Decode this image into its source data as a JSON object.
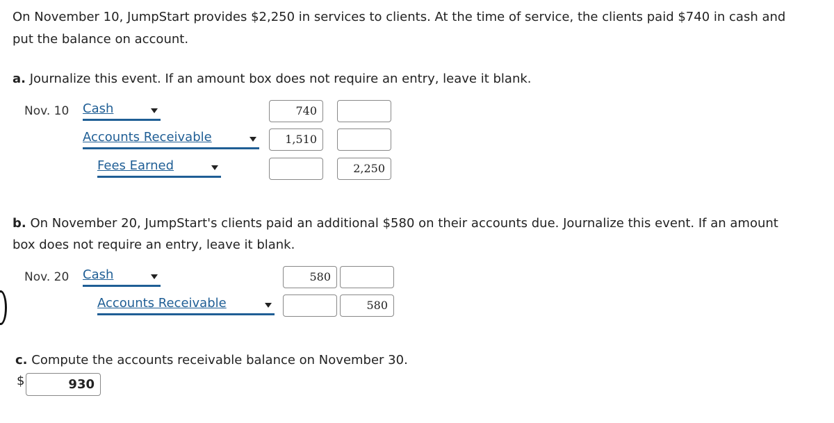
{
  "intro": [
    "On November 10, JumpStart provides $2,250 in services to clients. At the time of service, the clients paid $740 in cash and",
    "put the balance on account."
  ],
  "part_a": {
    "letter": "a.",
    "text": "Journalize this event. If an amount box does not require an entry, leave it blank.",
    "date": "Nov. 10",
    "rows": [
      {
        "account": "Cash",
        "debit": "740",
        "credit": ""
      },
      {
        "account": "Accounts Receivable",
        "debit": "1,510",
        "credit": ""
      },
      {
        "account": "Fees Earned",
        "debit": "",
        "credit": "2,250"
      }
    ]
  },
  "part_b": {
    "letter": "b.",
    "lines": [
      "On November 20, JumpStart's clients paid an additional $580 on their accounts due. Journalize this event. If an amount",
      "box does not require an entry, leave it blank."
    ],
    "date": "Nov. 20",
    "rows": [
      {
        "account": "Cash",
        "debit": "580",
        "credit": ""
      },
      {
        "account": "Accounts Receivable",
        "debit": "",
        "credit": "580"
      }
    ]
  },
  "part_c": {
    "letter": "c.",
    "text": "Compute the accounts receivable balance on November 30.",
    "currency": "$",
    "answer": "930"
  }
}
